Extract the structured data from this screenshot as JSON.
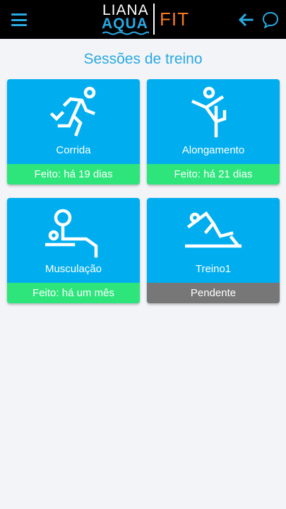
{
  "header": {
    "menu_icon": "hamburger-menu-icon",
    "logo": {
      "line1": "LIANA",
      "line2": "AQUA",
      "brand": "FIT"
    },
    "back_icon": "arrow-left-icon",
    "chat_icon": "chat-bubble-icon"
  },
  "page": {
    "title": "Sessões de treino"
  },
  "sessions": [
    {
      "name": "Corrida",
      "status": "Feito: há 19 dias",
      "state": "done",
      "icon": "running-icon"
    },
    {
      "name": "Alongamento",
      "status": "Feito: há 21 dias",
      "state": "done",
      "icon": "stretching-icon"
    },
    {
      "name": "Musculação",
      "status": "Feito: há um mês",
      "state": "done",
      "icon": "weightlifting-icon"
    },
    {
      "name": "Treino1",
      "status": "Pendente",
      "state": "pending",
      "icon": "situp-icon"
    }
  ],
  "colors": {
    "header_bg": "#000000",
    "accent_blue": "#29a9e1",
    "card_blue": "#00aeef",
    "brand_orange": "#f47b20",
    "done_green": "#2ee57c",
    "pending_gray": "#777777",
    "page_bg": "#f3f4f8"
  }
}
